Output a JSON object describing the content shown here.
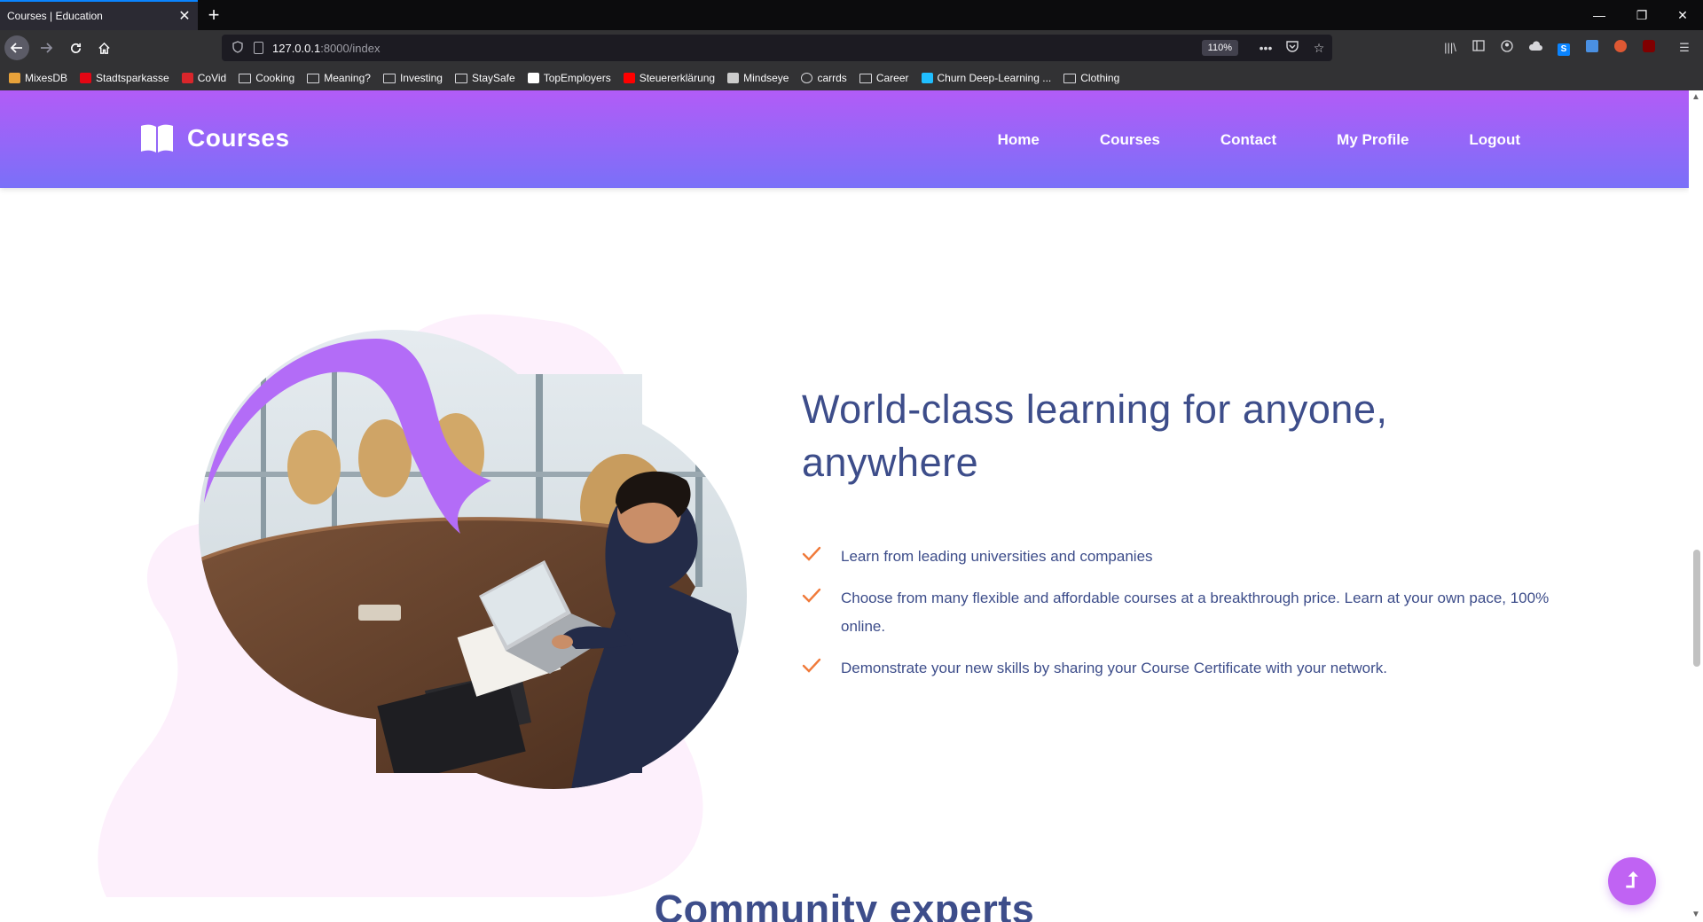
{
  "browser": {
    "tab_title": "Courses | Education",
    "tab_close": "✕",
    "new_tab": "+",
    "url_host": "127.0.0.1",
    "url_path": ":8000/index",
    "zoom": "110%",
    "window_controls": {
      "minimize": "—",
      "restore": "❐",
      "close": "✕"
    },
    "bookmarks": [
      {
        "label": "MixesDB",
        "icon": "mixesdb-icon"
      },
      {
        "label": "Stadtsparkasse",
        "icon": "sparkasse-icon"
      },
      {
        "label": "CoVid",
        "icon": "covid-icon"
      },
      {
        "label": "Cooking",
        "icon": "folder-icon"
      },
      {
        "label": "Meaning?",
        "icon": "folder-icon"
      },
      {
        "label": "Investing",
        "icon": "folder-icon"
      },
      {
        "label": "StaySafe",
        "icon": "folder-icon"
      },
      {
        "label": "TopEmployers",
        "icon": "medium-icon"
      },
      {
        "label": "Steuererklärung",
        "icon": "youtube-icon"
      },
      {
        "label": "Mindseye",
        "icon": "mindseye-icon"
      },
      {
        "label": "carrds",
        "icon": "globe-icon"
      },
      {
        "label": "Career",
        "icon": "folder-icon"
      },
      {
        "label": "Churn Deep-Learning ...",
        "icon": "kaggle-icon"
      },
      {
        "label": "Clothing",
        "icon": "folder-icon"
      }
    ]
  },
  "site": {
    "logo_text": "Courses",
    "nav": [
      "Home",
      "Courses",
      "Contact",
      "My Profile",
      "Logout"
    ]
  },
  "hero": {
    "headline_line1": "World-class learning for anyone,",
    "headline_line2": "anywhere",
    "features": [
      "Learn from leading universities and companies",
      "Choose from many flexible and affordable courses at a breakthrough price. Learn at your own pace, 100% online.",
      "Demonstrate your new skills by sharing your Course Certificate with your network."
    ]
  },
  "section2": {
    "title": "Community experts"
  },
  "back_to_top": "⮥",
  "colors": {
    "header_top": "#b25cf7",
    "header_bottom": "#7a70f8",
    "heading": "#3d4d8a",
    "check": "#f07a3a",
    "blob_light": "#fdf0fc",
    "blob_purple": "#b36cf7"
  }
}
